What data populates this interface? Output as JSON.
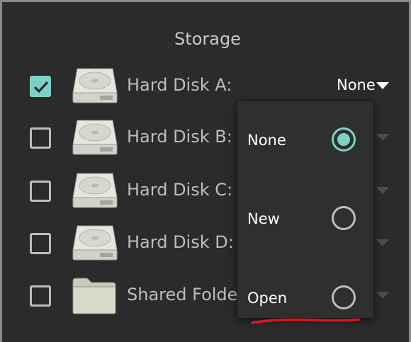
{
  "section": {
    "title": "Storage"
  },
  "rows": [
    {
      "label": "Hard Disk A:",
      "checked": true,
      "icon": "hard-disk-icon",
      "selected": "None"
    },
    {
      "label": "Hard Disk B:",
      "checked": false,
      "icon": "hard-disk-icon"
    },
    {
      "label": "Hard Disk C:",
      "checked": false,
      "icon": "hard-disk-icon"
    },
    {
      "label": "Hard Disk D:",
      "checked": false,
      "icon": "hard-disk-icon"
    },
    {
      "label": "Shared Folde",
      "checked": false,
      "icon": "folder-icon"
    }
  ],
  "menu": {
    "options": [
      {
        "label": "None",
        "selected": true
      },
      {
        "label": "New",
        "selected": false
      },
      {
        "label": "Open",
        "selected": false
      }
    ]
  },
  "colors": {
    "background": "#2b2b2b",
    "accent": "#7fd0c4",
    "text": "#bdbdbd",
    "annotation": "#e0141e"
  }
}
